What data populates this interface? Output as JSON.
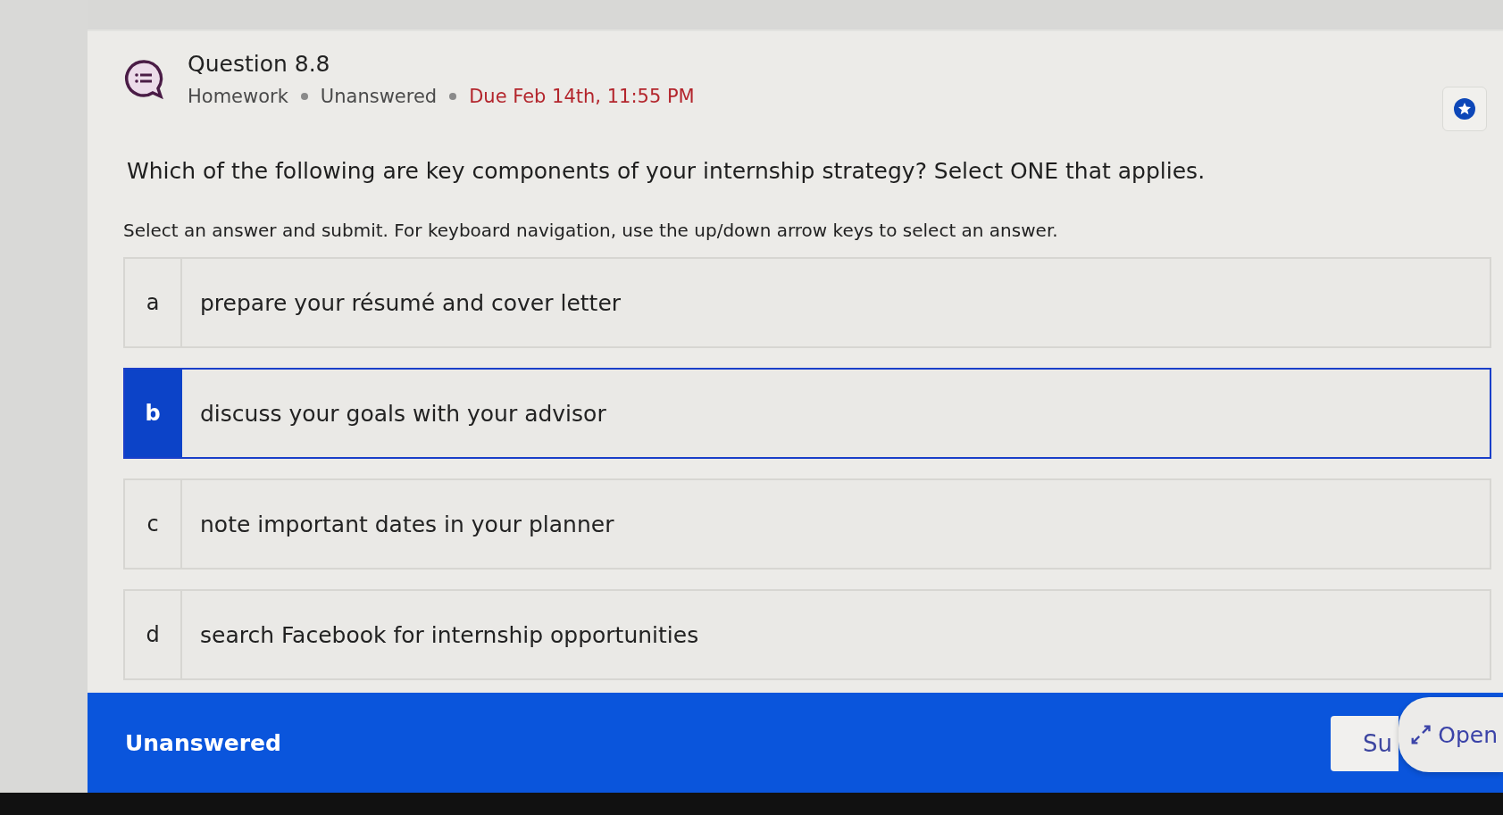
{
  "question": {
    "title": "Question 8.8",
    "meta": [
      "Homework",
      "Unanswered"
    ],
    "due": "Due Feb 14th, 11:55 PM"
  },
  "prompt": "Which of the following are key components of your internship strategy? Select ONE that applies.",
  "instruction": "Select an answer and submit. For keyboard navigation, use the up/down arrow keys to select an answer.",
  "options": [
    {
      "letter": "a",
      "text": "prepare your résumé and cover letter",
      "selected": false
    },
    {
      "letter": "b",
      "text": "discuss your goals with your advisor",
      "selected": true
    },
    {
      "letter": "c",
      "text": "note important dates in your planner",
      "selected": false
    },
    {
      "letter": "d",
      "text": "search Facebook for internship opportunities",
      "selected": false
    }
  ],
  "footer": {
    "status": "Unanswered",
    "submit": "Su",
    "open": "Open"
  }
}
